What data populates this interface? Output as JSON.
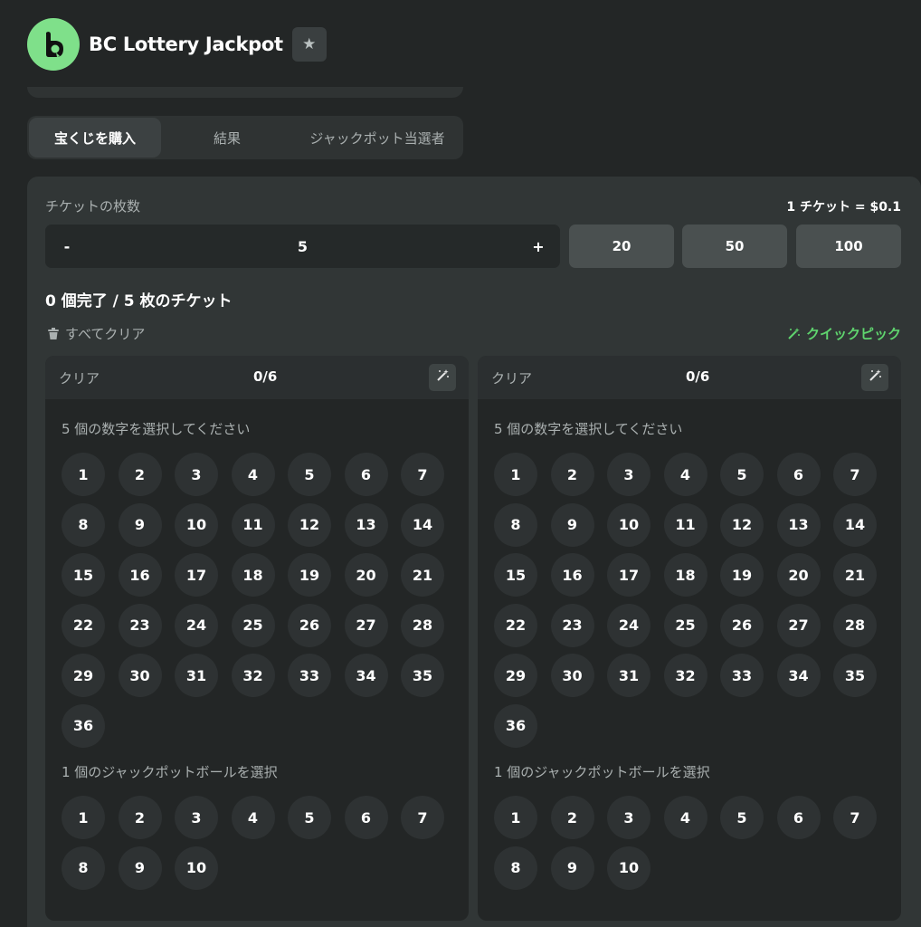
{
  "header": {
    "title": "BC Lottery Jackpot"
  },
  "tabs": [
    {
      "label": "宝くじを購入",
      "active": true
    },
    {
      "label": "結果",
      "active": false
    },
    {
      "label": "ジャックポット当選者",
      "active": false
    }
  ],
  "purchase": {
    "ticket_count_label": "チケットの枚数",
    "price_label": "1 チケット = $0.1",
    "minus_label": "-",
    "quantity": "5",
    "plus_label": "+",
    "presets": [
      "20",
      "50",
      "100"
    ],
    "progress_text": "0 個完了 / 5 枚のチケット",
    "clear_all_label": "すべてクリア",
    "quick_pick_label": "クイックピック"
  },
  "tickets": [
    {
      "clear_label": "クリア",
      "count": "0/6",
      "numbers_title": "5 個の数字を選択してください",
      "jackpot_title": "1 個のジャックポットボールを選択",
      "numbers": [
        "1",
        "2",
        "3",
        "4",
        "5",
        "6",
        "7",
        "8",
        "9",
        "10",
        "11",
        "12",
        "13",
        "14",
        "15",
        "16",
        "17",
        "18",
        "19",
        "20",
        "21",
        "22",
        "23",
        "24",
        "25",
        "26",
        "27",
        "28",
        "29",
        "30",
        "31",
        "32",
        "33",
        "34",
        "35",
        "36"
      ],
      "jackpot_numbers": [
        "1",
        "2",
        "3",
        "4",
        "5",
        "6",
        "7",
        "8",
        "9",
        "10"
      ]
    },
    {
      "clear_label": "クリア",
      "count": "0/6",
      "numbers_title": "5 個の数字を選択してください",
      "jackpot_title": "1 個のジャックポットボールを選択",
      "numbers": [
        "1",
        "2",
        "3",
        "4",
        "5",
        "6",
        "7",
        "8",
        "9",
        "10",
        "11",
        "12",
        "13",
        "14",
        "15",
        "16",
        "17",
        "18",
        "19",
        "20",
        "21",
        "22",
        "23",
        "24",
        "25",
        "26",
        "27",
        "28",
        "29",
        "30",
        "31",
        "32",
        "33",
        "34",
        "35",
        "36"
      ],
      "jackpot_numbers": [
        "1",
        "2",
        "3",
        "4",
        "5",
        "6",
        "7",
        "8",
        "9",
        "10"
      ]
    }
  ],
  "colors": {
    "accent_green": "#5fd46e",
    "logo_green": "#7fe08a",
    "background": "#232626"
  },
  "icons": {
    "logo": "bc-logo-icon",
    "favorite": "star-icon",
    "clear_all": "trash-icon",
    "quick_pick": "magic-wand-icon"
  }
}
